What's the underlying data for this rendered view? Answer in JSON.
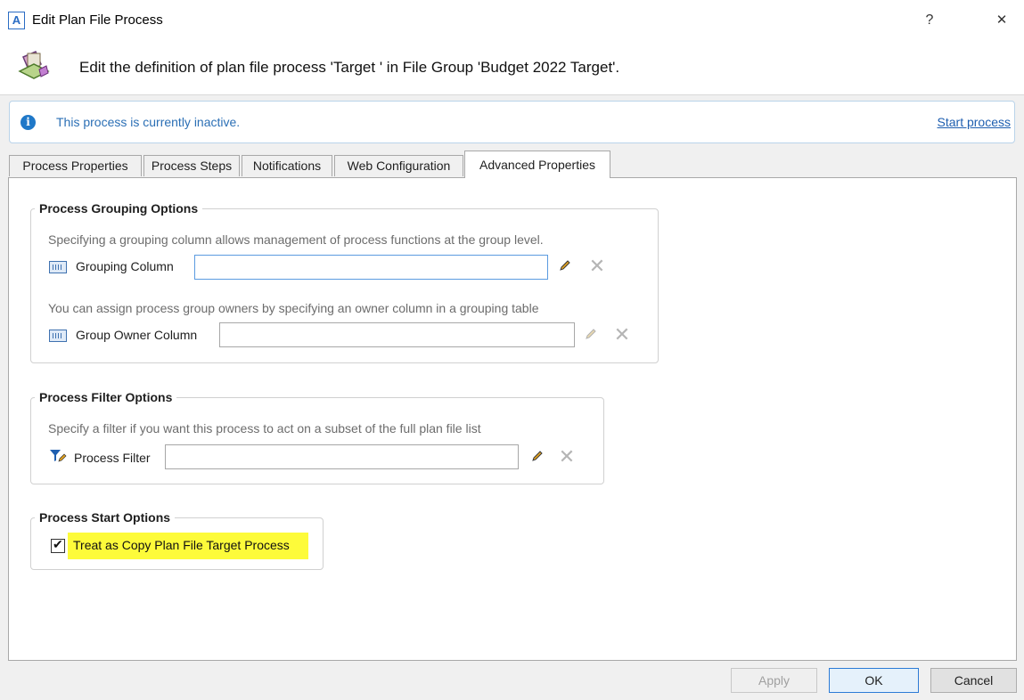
{
  "window": {
    "title": "Edit Plan File Process",
    "app_icon_letter": "A",
    "help_glyph": "?",
    "close_glyph": "✕"
  },
  "header": {
    "text": "Edit the definition of plan file process 'Target ' in File Group 'Budget 2022 Target'."
  },
  "info_banner": {
    "icon": "info-icon",
    "icon_glyph": "i",
    "text": "This process is currently inactive.",
    "link_label": "Start process"
  },
  "tabs": [
    {
      "label": "Process Properties",
      "active": false
    },
    {
      "label": "Process Steps",
      "active": false
    },
    {
      "label": "Notifications",
      "active": false
    },
    {
      "label": "Web Configuration",
      "active": false
    },
    {
      "label": "Advanced Properties",
      "active": true
    }
  ],
  "grouping": {
    "title": "Process Grouping Options",
    "desc1": "Specifying a grouping column allows management of process functions at the group level.",
    "field1_label": "Grouping Column",
    "field1_value": "",
    "desc2": "You can assign process group owners by specifying an owner column in a grouping table",
    "field2_label": "Group Owner Column",
    "field2_value": ""
  },
  "filter": {
    "title": "Process Filter Options",
    "desc": "Specify a filter if you want this process to act on a subset of the full plan file list",
    "field_label": "Process Filter",
    "field_value": ""
  },
  "start": {
    "title": "Process Start Options",
    "checkbox_label": "Treat as Copy Plan File Target Process",
    "checked": true,
    "check_glyph": "✔",
    "highlight_color": "#fdfb3a"
  },
  "buttons": {
    "apply": "Apply",
    "ok": "OK",
    "cancel": "Cancel"
  },
  "glyphs": {
    "clear": "✕"
  },
  "colors": {
    "accent": "#2c7bd6",
    "link": "#1f5fb0",
    "info": "#1f78c8"
  }
}
